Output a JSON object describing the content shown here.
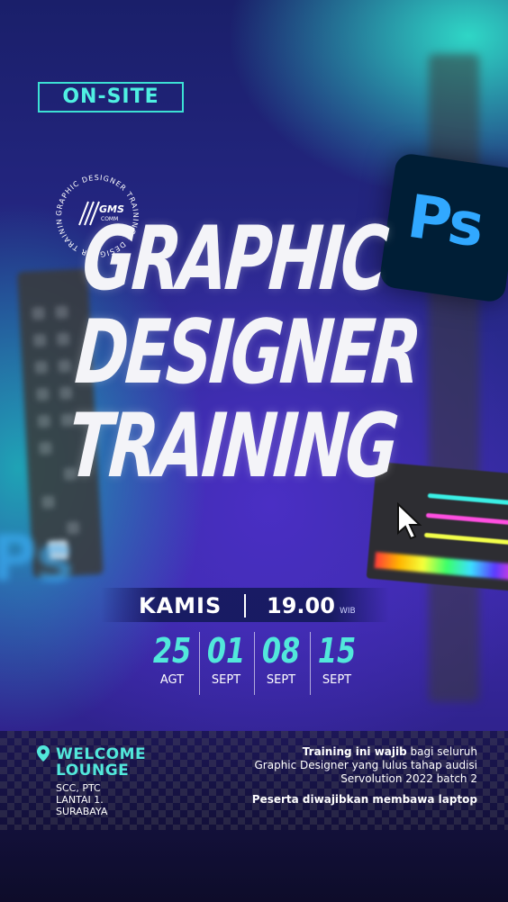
{
  "tag": "ON-SITE",
  "logo": {
    "ring_text": "GRAPHIC DESIGNER TRAINING · DESIGNER TRAINING",
    "brand_line1": "GMS",
    "brand_line2": "COMM"
  },
  "title": {
    "line1": "GRAPHIC",
    "line2": "DESIGNER",
    "line3": "TRAINING"
  },
  "app_badge": "Ps",
  "blurred_badge": "Ps",
  "schedule": {
    "day": "KAMIS",
    "time": "19.00",
    "timezone": "WIB",
    "dates": [
      {
        "day": "25",
        "month": "AGT"
      },
      {
        "day": "01",
        "month": "SEPT"
      },
      {
        "day": "08",
        "month": "SEPT"
      },
      {
        "day": "15",
        "month": "SEPT"
      }
    ]
  },
  "venue": {
    "name_line1": "WELCOME",
    "name_line2": "LOUNGE",
    "address_line1": "SCC, PTC",
    "address_line2": "LANTAI 1.",
    "address_line3": "SURABAYA"
  },
  "info": {
    "bold_lead": "Training ini wajib",
    "line1_rest": " bagi seluruh",
    "line2": "Graphic Designer yang lulus tahap audisi",
    "line3": "Servolution 2022 batch 2",
    "note": "Peserta diwajibkan membawa laptop"
  },
  "colors": {
    "accent": "#52e8db",
    "photoshop_blue": "#31a8ff",
    "photoshop_bg": "#001e36"
  }
}
